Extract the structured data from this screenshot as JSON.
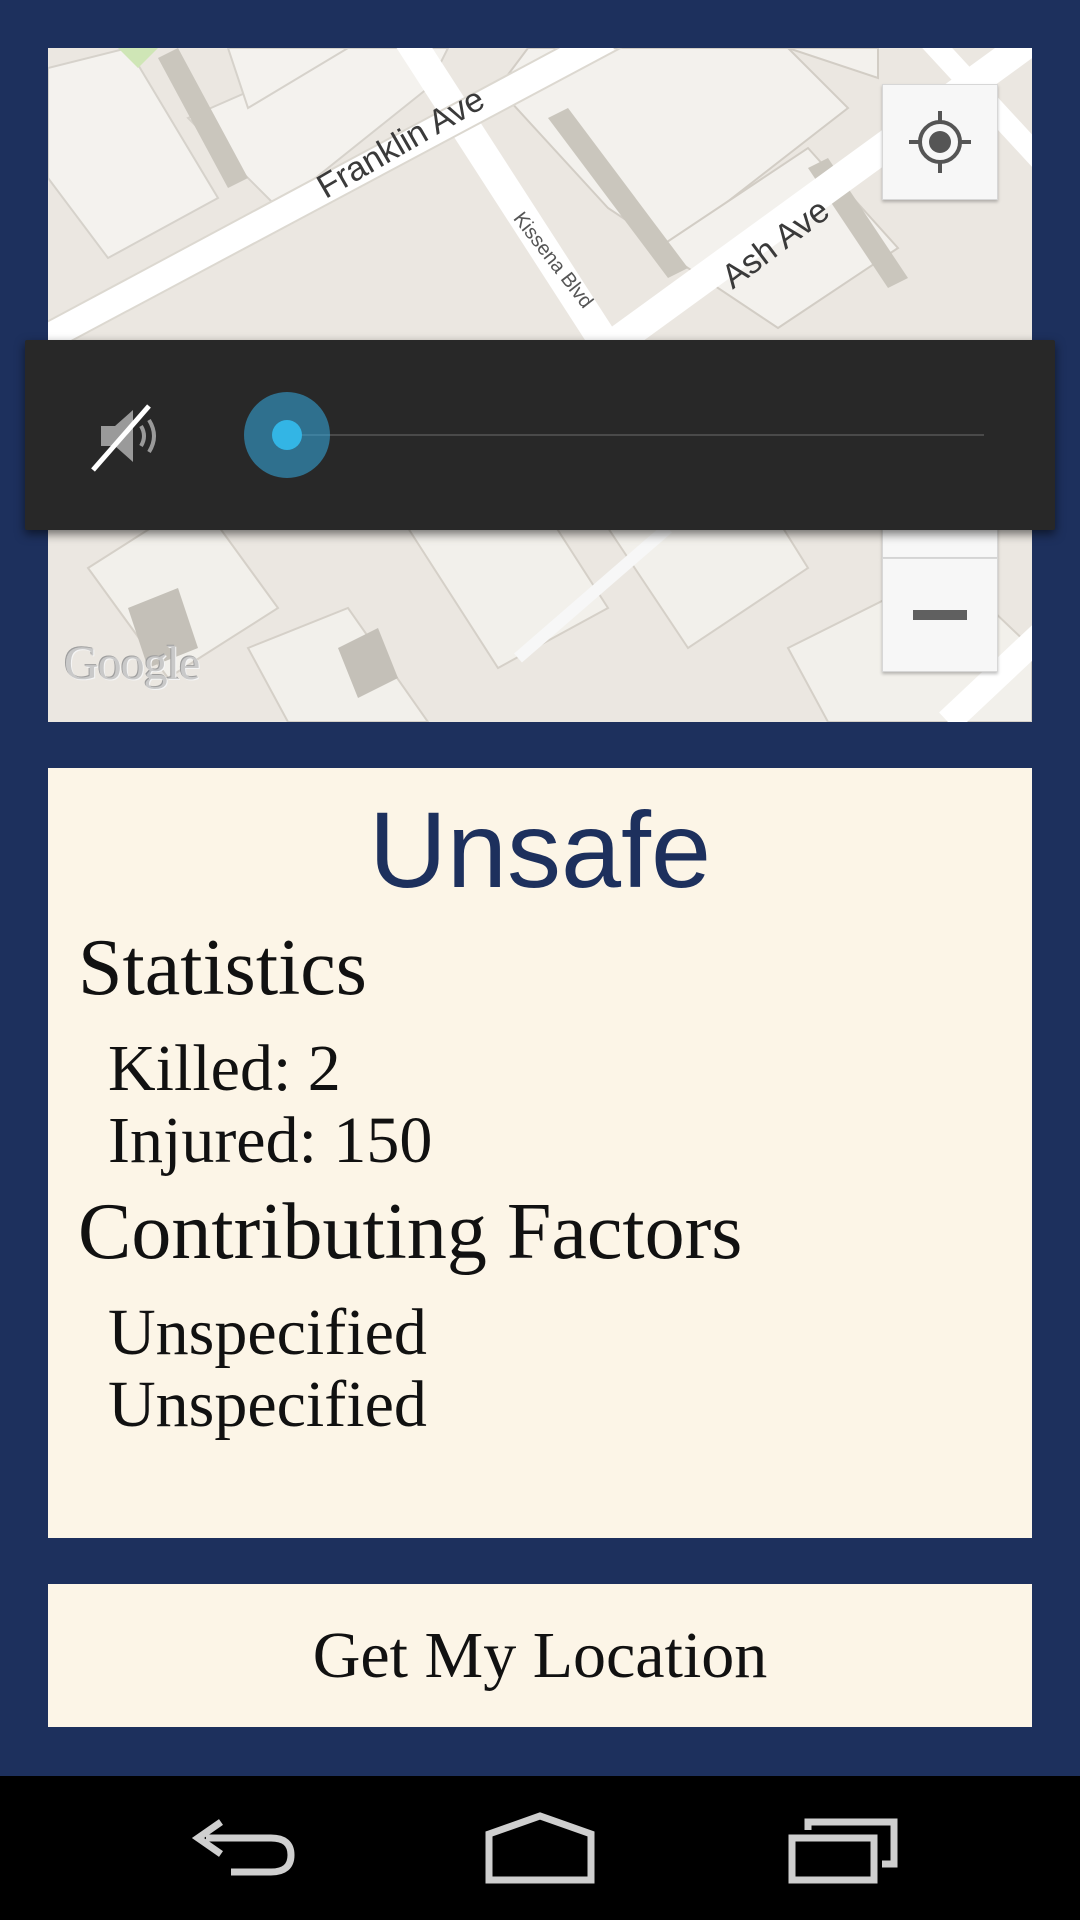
{
  "map": {
    "streets": {
      "franklin": "Franklin Ave",
      "ash": "Ash Ave",
      "kissena": "Kissena Blvd"
    },
    "attribution": "Google",
    "controls": {
      "locate_icon": "my-location-icon",
      "zoom_out_icon": "minus-icon"
    }
  },
  "volume": {
    "icon": "volume-muted-icon",
    "level": 0
  },
  "info": {
    "status": "Unsafe",
    "status_color": "#1d305d",
    "statistics_heading": "Statistics",
    "killed": "Killed: 2",
    "injured": "Injured: 150",
    "factors_heading": "Contributing Factors",
    "factors": [
      "Unspecified",
      "Unspecified"
    ]
  },
  "actions": {
    "get_location_label": "Get My Location"
  },
  "nav": {
    "back_icon": "back-icon",
    "home_icon": "home-icon",
    "recents_icon": "recents-icon"
  },
  "colors": {
    "background": "#1d305d",
    "card": "#fcf5e7",
    "accent": "#33b5e5"
  }
}
